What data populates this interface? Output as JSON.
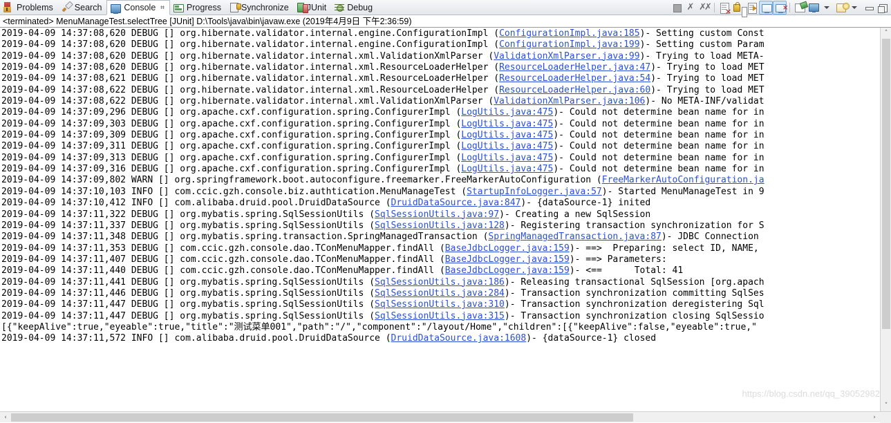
{
  "tabs": [
    {
      "label": "Problems",
      "icon": "problems-icon",
      "active": false
    },
    {
      "label": "Search",
      "icon": "search-icon",
      "active": false
    },
    {
      "label": "Console",
      "icon": "console-icon",
      "active": true,
      "close": "⌗"
    },
    {
      "label": "Progress",
      "icon": "progress-icon",
      "active": false
    },
    {
      "label": "Synchronize",
      "icon": "synchronize-icon",
      "active": false
    },
    {
      "label": "JUnit",
      "icon": "junit-icon",
      "active": false
    },
    {
      "label": "Debug",
      "icon": "debug-icon",
      "active": false
    }
  ],
  "toolbar": {
    "buttons": [
      {
        "name": "terminate-button",
        "tip": "Terminate"
      },
      {
        "name": "remove-launch-button",
        "tip": "Remove Launch"
      },
      {
        "name": "remove-all-terminated-button",
        "tip": "Remove All Terminated Launches"
      },
      {
        "name": "clear-console-button",
        "tip": "Clear Console"
      },
      {
        "name": "scroll-lock-button",
        "tip": "Scroll Lock"
      },
      {
        "name": "word-wrap-button",
        "tip": "Word Wrap"
      },
      {
        "name": "show-console-on-output-button",
        "tip": "Show Console When Standard Out Changes"
      },
      {
        "name": "show-console-on-error-button",
        "tip": "Show Console When Standard Error Changes"
      },
      {
        "name": "pin-console-button",
        "tip": "Pin Console"
      },
      {
        "name": "display-selected-console-button",
        "tip": "Display Selected Console"
      },
      {
        "name": "display-selected-console-menu",
        "tip": "Display Selected Console Menu"
      },
      {
        "name": "open-console-button",
        "tip": "Open Console"
      },
      {
        "name": "open-console-menu",
        "tip": "Open Console Menu"
      },
      {
        "name": "minimize-button",
        "tip": "Minimize"
      },
      {
        "name": "maximize-button",
        "tip": "Maximize"
      }
    ]
  },
  "process_header": "<terminated> MenuManageTest.selectTree [JUnit] D:\\Tools\\java\\bin\\javaw.exe (2019年4月9日 下午2:36:59)",
  "console": {
    "lines": [
      {
        "pre": "2019-04-09 14:37:08,620 DEBUG [] org.hibernate.validator.internal.engine.ConfigurationImpl (",
        "link": "ConfigurationImpl.java:185",
        "post": ")- Setting custom Const"
      },
      {
        "pre": "2019-04-09 14:37:08,620 DEBUG [] org.hibernate.validator.internal.engine.ConfigurationImpl (",
        "link": "ConfigurationImpl.java:199",
        "post": ")- Setting custom Param"
      },
      {
        "pre": "2019-04-09 14:37:08,620 DEBUG [] org.hibernate.validator.internal.xml.ValidationXmlParser (",
        "link": "ValidationXmlParser.java:99",
        "post": ")- Trying to load META-"
      },
      {
        "pre": "2019-04-09 14:37:08,620 DEBUG [] org.hibernate.validator.internal.xml.ResourceLoaderHelper (",
        "link": "ResourceLoaderHelper.java:47",
        "post": ")- Trying to load MET"
      },
      {
        "pre": "2019-04-09 14:37:08,621 DEBUG [] org.hibernate.validator.internal.xml.ResourceLoaderHelper (",
        "link": "ResourceLoaderHelper.java:54",
        "post": ")- Trying to load MET"
      },
      {
        "pre": "2019-04-09 14:37:08,622 DEBUG [] org.hibernate.validator.internal.xml.ResourceLoaderHelper (",
        "link": "ResourceLoaderHelper.java:60",
        "post": ")- Trying to load MET"
      },
      {
        "pre": "2019-04-09 14:37:08,622 DEBUG [] org.hibernate.validator.internal.xml.ValidationXmlParser (",
        "link": "ValidationXmlParser.java:106",
        "post": ")- No META-INF/validat"
      },
      {
        "pre": "2019-04-09 14:37:09,296 DEBUG [] org.apache.cxf.configuration.spring.ConfigurerImpl (",
        "link": "LogUtils.java:475",
        "post": ")- Could not determine bean name for in"
      },
      {
        "pre": "2019-04-09 14:37:09,303 DEBUG [] org.apache.cxf.configuration.spring.ConfigurerImpl (",
        "link": "LogUtils.java:475",
        "post": ")- Could not determine bean name for in"
      },
      {
        "pre": "2019-04-09 14:37:09,309 DEBUG [] org.apache.cxf.configuration.spring.ConfigurerImpl (",
        "link": "LogUtils.java:475",
        "post": ")- Could not determine bean name for in"
      },
      {
        "pre": "2019-04-09 14:37:09,311 DEBUG [] org.apache.cxf.configuration.spring.ConfigurerImpl (",
        "link": "LogUtils.java:475",
        "post": ")- Could not determine bean name for in"
      },
      {
        "pre": "2019-04-09 14:37:09,313 DEBUG [] org.apache.cxf.configuration.spring.ConfigurerImpl (",
        "link": "LogUtils.java:475",
        "post": ")- Could not determine bean name for in"
      },
      {
        "pre": "2019-04-09 14:37:09,316 DEBUG [] org.apache.cxf.configuration.spring.ConfigurerImpl (",
        "link": "LogUtils.java:475",
        "post": ")- Could not determine bean name for in"
      },
      {
        "pre": "2019-04-09 14:37:09,802 WARN [] org.springframework.boot.autoconfigure.freemarker.FreeMarkerAutoConfiguration (",
        "link": "FreeMarkerAutoConfiguration.ja",
        "post": ""
      },
      {
        "pre": "2019-04-09 14:37:10,103 INFO [] com.ccic.gzh.console.biz.authtication.MenuManageTest (",
        "link": "StartupInfoLogger.java:57",
        "post": ")- Started MenuManageTest in 9"
      },
      {
        "pre": "2019-04-09 14:37:10,412 INFO [] com.alibaba.druid.pool.DruidDataSource (",
        "link": "DruidDataSource.java:847",
        "post": ")- {dataSource-1} inited"
      },
      {
        "pre": "2019-04-09 14:37:11,322 DEBUG [] org.mybatis.spring.SqlSessionUtils (",
        "link": "SqlSessionUtils.java:97",
        "post": ")- Creating a new SqlSession"
      },
      {
        "pre": "2019-04-09 14:37:11,337 DEBUG [] org.mybatis.spring.SqlSessionUtils (",
        "link": "SqlSessionUtils.java:128",
        "post": ")- Registering transaction synchronization for S"
      },
      {
        "pre": "2019-04-09 14:37:11,348 DEBUG [] org.mybatis.spring.transaction.SpringManagedTransaction (",
        "link": "SpringManagedTransaction.java:87",
        "post": ")- JDBC Connection"
      },
      {
        "pre": "2019-04-09 14:37:11,353 DEBUG [] com.ccic.gzh.console.dao.TConMenuMapper.findAll (",
        "link": "BaseJdbcLogger.java:159",
        "post": ")- ==>  Preparing: select ID, NAME,"
      },
      {
        "pre": "2019-04-09 14:37:11,407 DEBUG [] com.ccic.gzh.console.dao.TConMenuMapper.findAll (",
        "link": "BaseJdbcLogger.java:159",
        "post": ")- ==> Parameters:"
      },
      {
        "pre": "2019-04-09 14:37:11,440 DEBUG [] com.ccic.gzh.console.dao.TConMenuMapper.findAll (",
        "link": "BaseJdbcLogger.java:159",
        "post": ")- <==      Total: 41"
      },
      {
        "pre": "2019-04-09 14:37:11,441 DEBUG [] org.mybatis.spring.SqlSessionUtils (",
        "link": "SqlSessionUtils.java:186",
        "post": ")- Releasing transactional SqlSession [org.apach"
      },
      {
        "pre": "2019-04-09 14:37:11,446 DEBUG [] org.mybatis.spring.SqlSessionUtils (",
        "link": "SqlSessionUtils.java:284",
        "post": ")- Transaction synchronization committing SqlSes"
      },
      {
        "pre": "2019-04-09 14:37:11,447 DEBUG [] org.mybatis.spring.SqlSessionUtils (",
        "link": "SqlSessionUtils.java:310",
        "post": ")- Transaction synchronization deregistering Sql"
      },
      {
        "pre": "2019-04-09 14:37:11,447 DEBUG [] org.mybatis.spring.SqlSessionUtils (",
        "link": "SqlSessionUtils.java:315",
        "post": ")- Transaction synchronization closing SqlSessio"
      },
      {
        "pre": "[{\"keepAlive\":true,\"eyeable\":true,\"title\":\"测试菜单001\",\"path\":\"/\",\"component\":\"/layout/Home\",\"children\":[{\"keepAlive\":false,\"eyeable\":true,\"",
        "link": "",
        "post": ""
      },
      {
        "pre": "2019-04-09 14:37:11,572 INFO [] com.alibaba.druid.pool.DruidDataSource (",
        "link": "DruidDataSource.java:1608",
        "post": ")- {dataSource-1} closed"
      }
    ]
  },
  "scrollbars": {
    "vertical": {
      "up": "˄",
      "down": "˅"
    },
    "horizontal": {
      "left": "‹",
      "right": "›"
    }
  },
  "watermark": "https://blog.csdn.net/qq_39052982",
  "colors": {
    "link": "#2a4fdb",
    "text": "#000000",
    "tab_active_bg": "#ffffff",
    "chrome_bg": "#f0f0f0",
    "selected_tool_bg": "#cfe3f6"
  }
}
